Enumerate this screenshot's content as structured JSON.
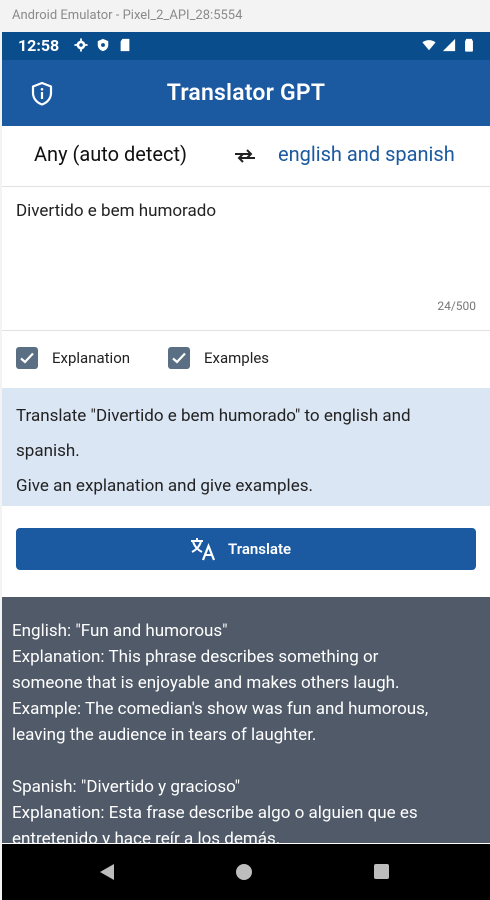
{
  "window": {
    "title": "Android Emulator - Pixel_2_API_28:5554"
  },
  "status_bar": {
    "time": "12:58",
    "left_icons": [
      "gear-icon",
      "shield-icon",
      "sd-card-icon"
    ],
    "right_icons": [
      "wifi-icon",
      "signal-icon",
      "battery-icon"
    ]
  },
  "app_bar": {
    "title": "Translator GPT",
    "privacy_icon": "shield-info-icon"
  },
  "language_row": {
    "source": "Any (auto detect)",
    "swap_icon": "swap-arrows-icon",
    "target": "english and spanish"
  },
  "input": {
    "value": "Divertido e bem humorado",
    "char_count": "24/500"
  },
  "options": {
    "explanation_label": "Explanation",
    "explanation_checked": true,
    "examples_label": "Examples",
    "examples_checked": true
  },
  "prompt": {
    "line1": "Translate \"Divertido e bem humorado\" to english and",
    "line2": "spanish.",
    "line3": "Give an explanation and give examples."
  },
  "translate_button": {
    "label": "Translate",
    "icon": "translate-icon"
  },
  "result": {
    "lines": [
      "English: \"Fun and humorous\"",
      "Explanation: This phrase describes something or",
      "someone that is enjoyable and makes others laugh.",
      "Example: The comedian's show was fun and humorous,",
      "leaving the audience in tears of laughter.",
      "",
      "Spanish: \"Divertido y gracioso\"",
      "Explanation: Esta frase describe algo o alguien que es",
      "entretenido y hace reír a los demás."
    ]
  },
  "colors": {
    "status_bar": "#0a4d8c",
    "app_bar": "#1b5aa0",
    "accent": "#1b5aa0",
    "prompt_bg": "#dbe6f4",
    "result_bg": "#505a69",
    "checkbox": "#5a6f84"
  }
}
